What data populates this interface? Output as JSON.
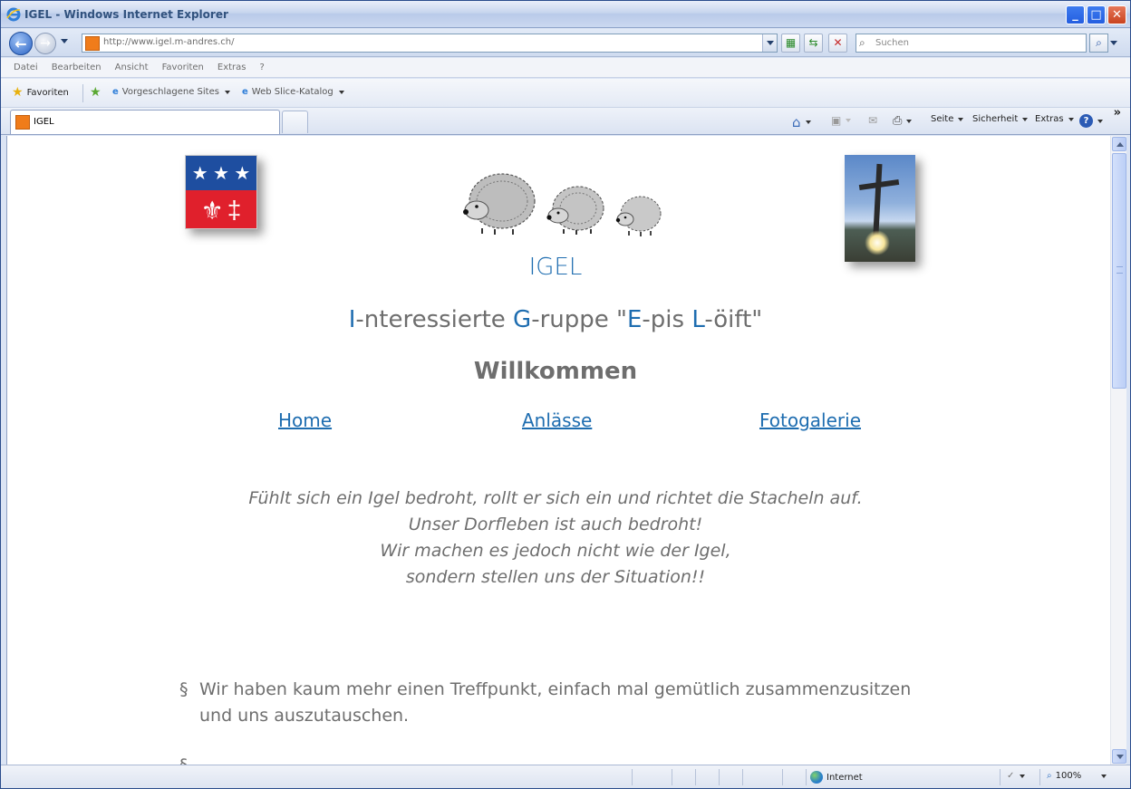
{
  "window": {
    "title": "IGEL - Windows Internet Explorer",
    "minimize": "_",
    "maximize": "□",
    "close": "✕"
  },
  "addressbar": {
    "url": "http://www.igel.m-andres.ch/",
    "search_placeholder": "Suchen"
  },
  "menubar": {
    "items": [
      "Datei",
      "Bearbeiten",
      "Ansicht",
      "Favoriten",
      "Extras",
      "?"
    ]
  },
  "favbar": {
    "favorites_label": "Favoriten",
    "suggested_sites": "Vorgeschlagene Sites",
    "web_slice": "Web Slice-Katalog"
  },
  "tabs": {
    "active_label": "IGEL"
  },
  "commandbar": {
    "seite": "Seite",
    "sicherheit": "Sicherheit",
    "extras": "Extras"
  },
  "page": {
    "site_title": "IGEL",
    "subtitle": {
      "l1": "I",
      "t1": "-nteressierte ",
      "l2": "G",
      "t2": "-ruppe \"",
      "l3": "E",
      "t3": "-pis ",
      "l4": "L",
      "t4": "-öift\""
    },
    "welcome": "Willkommen",
    "nav": {
      "home": "Home",
      "events": "Anlässe",
      "gallery": "Fotogalerie"
    },
    "quote": [
      "Fühlt sich ein Igel bedroht, rollt er sich ein und richtet die Stacheln auf.",
      "Unser Dorfleben ist auch bedroht!",
      "Wir machen es jedoch nicht wie der Igel,",
      "sondern stellen uns der Situation!!"
    ],
    "paragraph_symbol": "§",
    "paragraph1_line1": "Wir haben kaum mehr einen Treffpunkt, einfach mal gemütlich zusammenzusitzen",
    "paragraph1_line2": "und uns auszutauschen."
  },
  "statusbar": {
    "zone": "Internet",
    "zoom": "100%"
  },
  "colors": {
    "link_blue": "#1e6db0",
    "text_gray": "#6e6e6e",
    "flag_blue": "#1e4ea0",
    "flag_red": "#e0202c"
  }
}
